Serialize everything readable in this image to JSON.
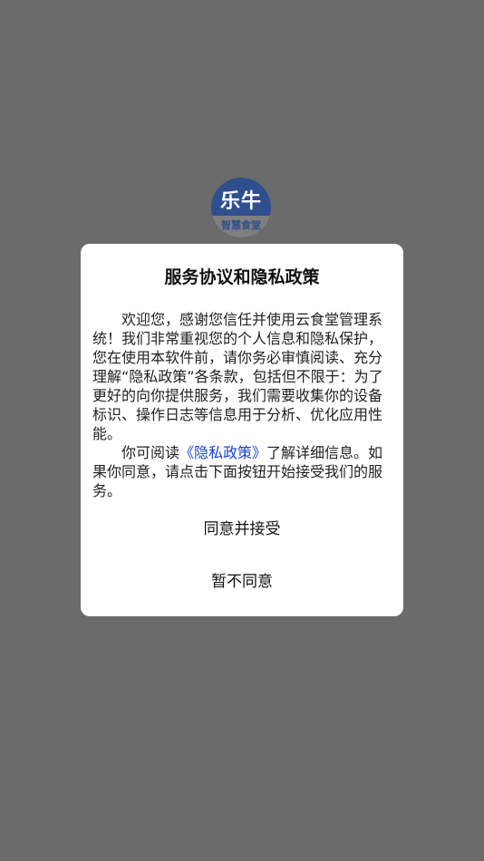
{
  "logo": {
    "brand": "乐牛",
    "subtitle": "智慧食堂"
  },
  "dialog": {
    "title": "服务协议和隐私政策",
    "paragraph1": "欢迎您，感谢您信任并使用云食堂管理系统！我们非常重视您的个人信息和隐私保护，您在使用本软件前，请你务必审慎阅读、充分理解“隐私政策”各条款，包括但不限于：为了更好的向你提供服务，我们需要收集你的设备标识、操作日志等信息用于分析、优化应用性能。",
    "paragraph2_prefix": "你可阅读",
    "privacy_link": "《隐私政策》",
    "paragraph2_suffix": "了解详细信息。如果你同意，请点击下面按钮开始接受我们的服务。",
    "agree_label": "同意并接受",
    "decline_label": "暂不同意"
  },
  "colors": {
    "overlay": "#6b6b6b",
    "dialog_bg": "#ffffff",
    "link": "#1a3fd6",
    "logo_blue": "#2f4f8f"
  }
}
